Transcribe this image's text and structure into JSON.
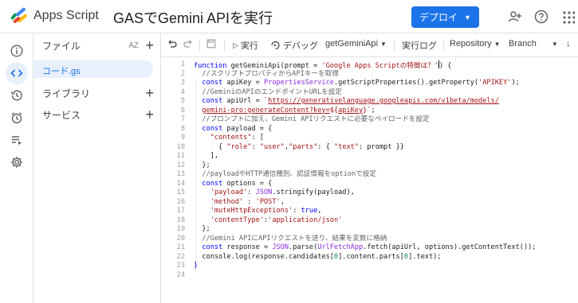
{
  "header": {
    "app_name": "Apps Script",
    "project_title": "GASでGemini APIを実行",
    "deploy_label": "デプロイ",
    "icons": [
      "apps-script-logo",
      "add-person-icon",
      "help-icon",
      "apps-grid-icon"
    ]
  },
  "rail": {
    "icons": [
      "info-icon",
      "code-icon",
      "history-icon",
      "triggers-icon",
      "executions-icon",
      "settings-icon"
    ]
  },
  "files_panel": {
    "files_label": "ファイル",
    "sort_label": "AZ",
    "file_name": "コード.gs",
    "libraries_label": "ライブラリ",
    "services_label": "サービス"
  },
  "toolbar": {
    "run_label": "実行",
    "debug_label": "デバッグ",
    "function_name": "getGeminiApi",
    "exec_log_label": "実行ログ",
    "repository_label": "Repository",
    "branch_label": "Branch"
  },
  "editor": {
    "line_numbers": [
      "1",
      "2",
      "3",
      "4",
      "5",
      "6",
      "7",
      "8",
      "9",
      "10",
      "11",
      "12",
      "13",
      "14",
      "15",
      "16",
      "17",
      "18",
      "19",
      "20",
      "21",
      "22",
      "23",
      "24"
    ]
  },
  "colors": {
    "accent": "#1a73e8",
    "keyword": "#0000ff",
    "string": "#a31515",
    "property": "#8a2be2",
    "active_bg": "#e8f0fe"
  }
}
